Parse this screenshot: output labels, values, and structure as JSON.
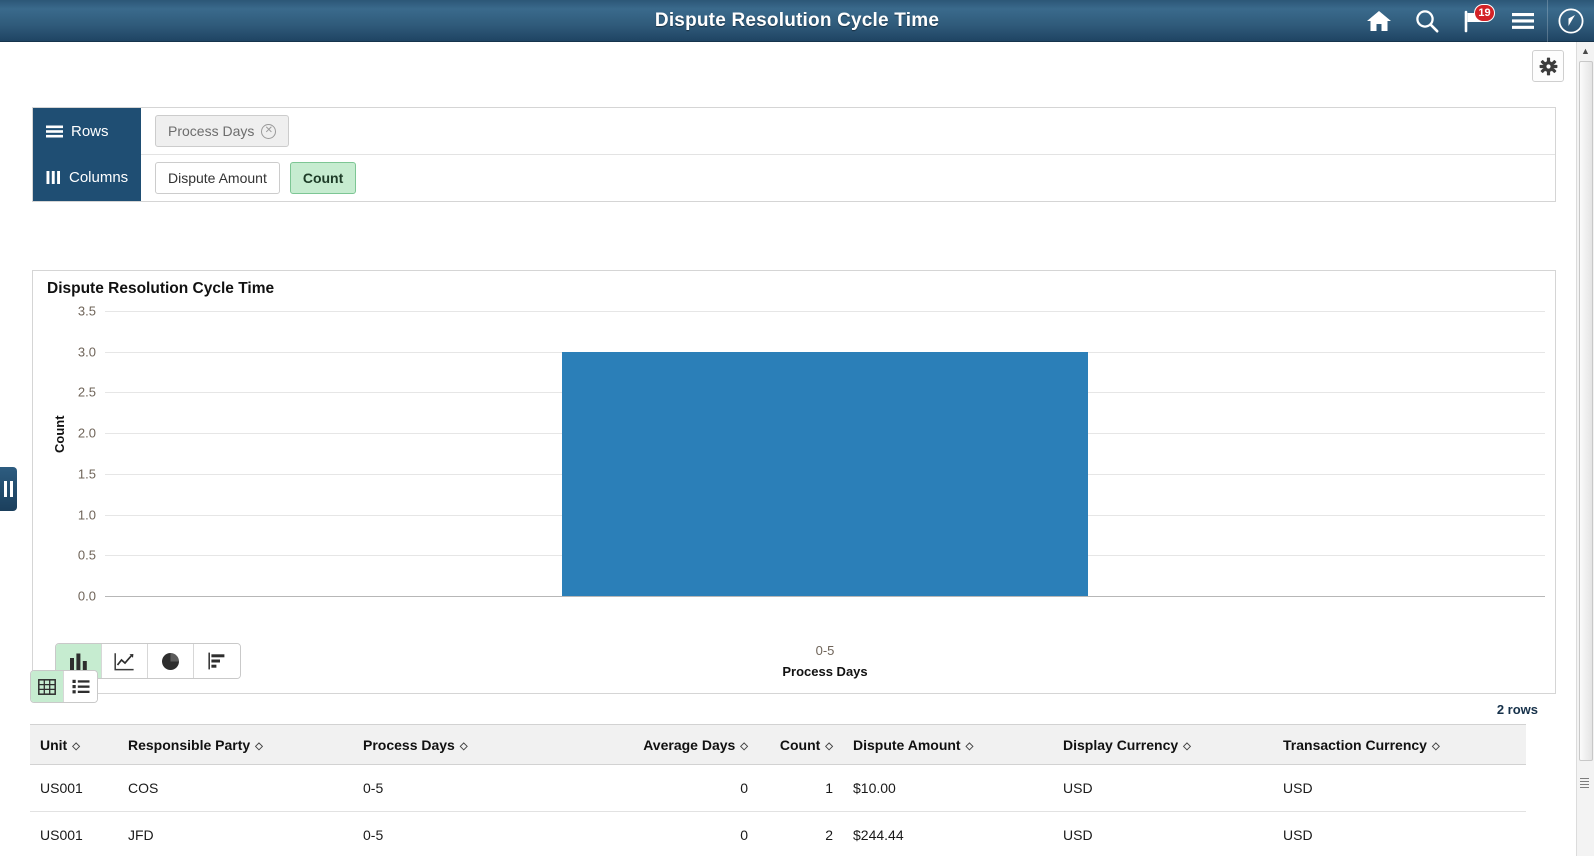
{
  "header": {
    "title": "Dispute Resolution Cycle Time",
    "icons": [
      {
        "name": "home-icon",
        "label": "Home"
      },
      {
        "name": "search-icon",
        "label": "Search"
      },
      {
        "name": "notifications-flag-icon",
        "label": "Notifications",
        "badge": "19"
      },
      {
        "name": "hamburger-menu-icon",
        "label": "Actions Menu"
      },
      {
        "name": "navbar-compass-icon",
        "label": "NavBar"
      }
    ],
    "notification_count": "19"
  },
  "toolbar": {
    "gear_label": "Settings"
  },
  "facets": {
    "rows_label": "Rows",
    "columns_label": "Columns",
    "row_chips": [
      {
        "label": "Process Days",
        "removable": true,
        "active": false
      }
    ],
    "column_chips": [
      {
        "label": "Dispute Amount",
        "active": false
      },
      {
        "label": "Count",
        "active": true
      }
    ]
  },
  "chart_data": {
    "type": "bar",
    "title": "Dispute Resolution Cycle Time",
    "xlabel": "Process Days",
    "ylabel": "Count",
    "categories": [
      "0-5"
    ],
    "values": [
      3
    ],
    "ylim": [
      0,
      3.5
    ],
    "yticks": [
      "0.0",
      "0.5",
      "1.0",
      "1.5",
      "2.0",
      "2.5",
      "3.0",
      "3.5"
    ],
    "ytick_values": [
      0,
      0.5,
      1,
      1.5,
      2,
      2.5,
      3,
      3.5
    ],
    "grid": true,
    "legend": "none",
    "bar_color": "#2b7fb8",
    "series": [
      {
        "name": "Count",
        "values": [
          3
        ]
      }
    ]
  },
  "chart_types": [
    {
      "name": "bar-chart-icon",
      "label": "Bar Chart",
      "selected": true
    },
    {
      "name": "line-chart-icon",
      "label": "Line Chart",
      "selected": false
    },
    {
      "name": "pie-chart-icon",
      "label": "Pie Chart",
      "selected": false
    },
    {
      "name": "horizontal-bar-chart-icon",
      "label": "Horizontal Bar Chart",
      "selected": false
    }
  ],
  "view_toggle": [
    {
      "name": "grid-view-icon",
      "label": "Grid View",
      "selected": true
    },
    {
      "name": "list-view-icon",
      "label": "List View",
      "selected": false
    }
  ],
  "table": {
    "row_count_label": "2 rows",
    "columns": [
      {
        "key": "unit",
        "label": "Unit",
        "align": "left"
      },
      {
        "key": "responsible_party",
        "label": "Responsible Party",
        "align": "left"
      },
      {
        "key": "process_days",
        "label": "Process Days",
        "align": "left"
      },
      {
        "key": "average_days",
        "label": "Average Days",
        "align": "right"
      },
      {
        "key": "count",
        "label": "Count",
        "align": "right"
      },
      {
        "key": "dispute_amount",
        "label": "Dispute Amount",
        "align": "left"
      },
      {
        "key": "display_currency",
        "label": "Display Currency",
        "align": "left"
      },
      {
        "key": "transaction_currency",
        "label": "Transaction Currency",
        "align": "left"
      }
    ],
    "rows": [
      {
        "unit": "US001",
        "responsible_party": "COS",
        "process_days": "0-5",
        "average_days": "0",
        "count": "1",
        "dispute_amount": "$10.00",
        "display_currency": "USD",
        "transaction_currency": "USD"
      },
      {
        "unit": "US001",
        "responsible_party": "JFD",
        "process_days": "0-5",
        "average_days": "0",
        "count": "2",
        "dispute_amount": "$244.44",
        "display_currency": "USD",
        "transaction_currency": "USD"
      }
    ]
  },
  "colors": {
    "header_blue": "#2f5a7a",
    "facet_panel_blue": "#1f4e73",
    "bar_blue": "#2b7fb8",
    "active_green": "#c6ecd0",
    "badge_red": "#d32227"
  }
}
